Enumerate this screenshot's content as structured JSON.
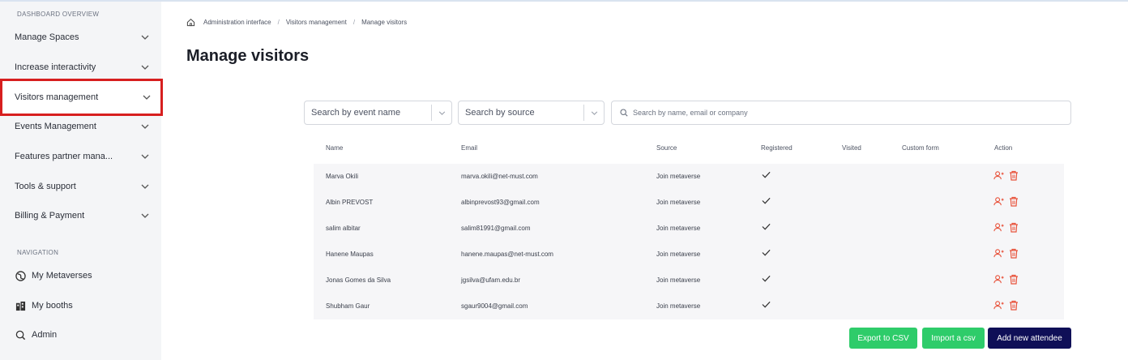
{
  "colors": {
    "accent_red": "#d71f1f",
    "green": "#2ecc6a",
    "navy": "#0f0f57",
    "action_icon": "#e8533c"
  },
  "sidebar": {
    "overview_title": "DASHBOARD OVERVIEW",
    "items": [
      {
        "label": "Manage Spaces"
      },
      {
        "label": "Increase interactivity"
      },
      {
        "label": "Visitors management"
      },
      {
        "label": "Events Management"
      },
      {
        "label": "Features partner mana..."
      },
      {
        "label": "Tools & support"
      },
      {
        "label": "Billing & Payment"
      }
    ],
    "navigation_title": "NAVIGATION",
    "nav": [
      {
        "label": "My Metaverses",
        "icon": "globe-icon"
      },
      {
        "label": "My booths",
        "icon": "booths-icon"
      },
      {
        "label": "Admin",
        "icon": "admin-icon"
      }
    ]
  },
  "breadcrumb": {
    "items": [
      "Administration interface",
      "Visitors management",
      "Manage visitors"
    ],
    "separator": "/"
  },
  "page": {
    "title": "Manage visitors"
  },
  "filters": {
    "event_placeholder": "Search by event name",
    "source_placeholder": "Search by source",
    "search_placeholder": "Search by name, email or company"
  },
  "table": {
    "columns": [
      "Name",
      "Email",
      "Source",
      "Registered",
      "Visited",
      "Custom form",
      "Action"
    ],
    "rows": [
      {
        "name": "Marva Okili",
        "email": "marva.okili@net-must.com",
        "source": "Join metaverse",
        "registered": "✓"
      },
      {
        "name": "Albin PREVOST",
        "email": "albinprevost93@gmail.com",
        "source": "Join metaverse",
        "registered": "✓"
      },
      {
        "name": "salim albitar",
        "email": "salim81991@gmail.com",
        "source": "Join metaverse",
        "registered": "✓"
      },
      {
        "name": "Hanene Maupas",
        "email": "hanene.maupas@net-must.com",
        "source": "Join metaverse",
        "registered": "✓"
      },
      {
        "name": "Jonas Gomes da Silva",
        "email": "jgsilva@ufam.edu.br",
        "source": "Join metaverse",
        "registered": "✓"
      },
      {
        "name": "Shubham Gaur",
        "email": "sgaur9004@gmail.com",
        "source": "Join metaverse",
        "registered": "✓"
      }
    ]
  },
  "buttons": {
    "export": "Export to CSV",
    "import": "Import a csv",
    "add": "Add new attendee"
  }
}
